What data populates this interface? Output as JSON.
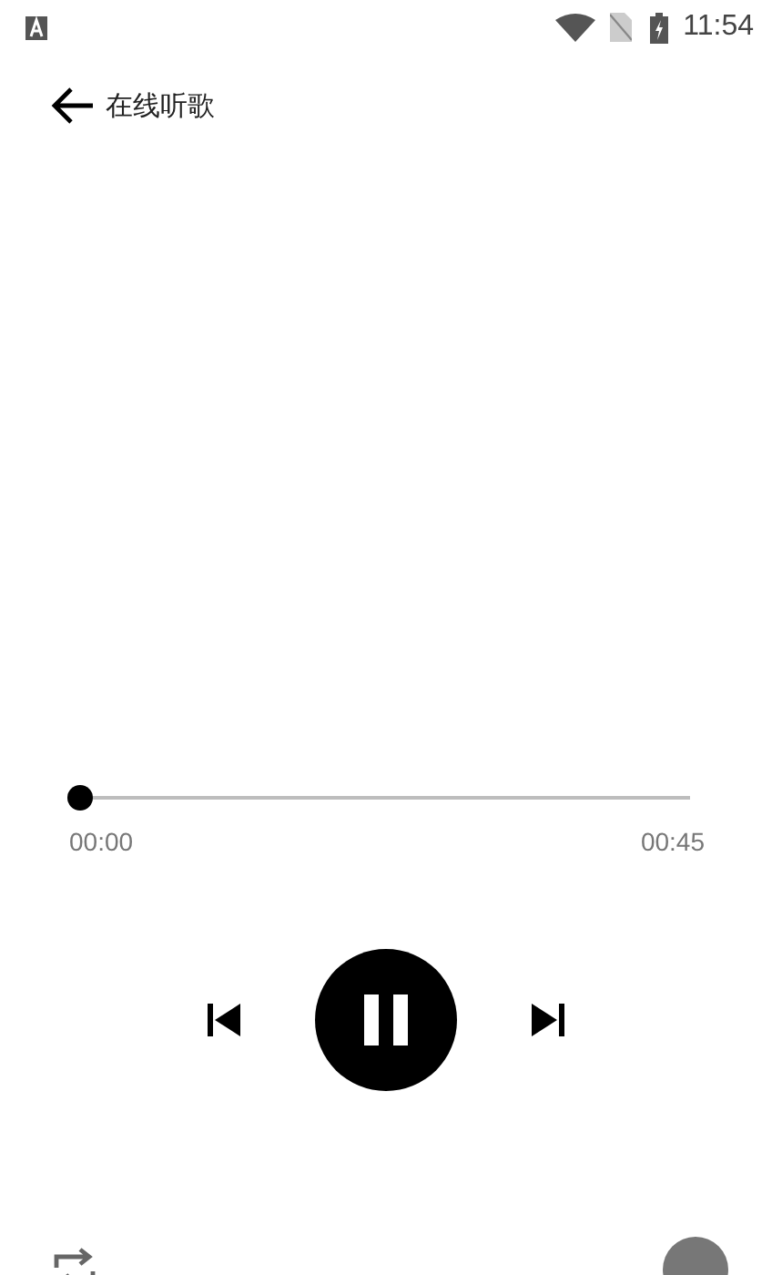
{
  "status_bar": {
    "time": "11:54"
  },
  "toolbar": {
    "title": "在线听歌"
  },
  "player": {
    "level": 0,
    "elapsed": "00:00",
    "duration": "00:45",
    "playing": true
  }
}
